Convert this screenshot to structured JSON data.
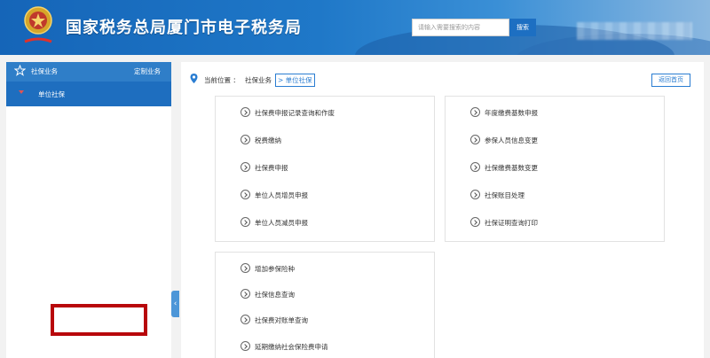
{
  "header": {
    "title": "国家税务总局厦门市电子税务局",
    "search_placeholder": "请输入需要搜索的内容",
    "search_button": "搜索",
    "brand_color": "#1f78c8"
  },
  "sidebar": {
    "section_label": "社保业务",
    "custom_label": "定制业务",
    "active_item": "单位社保",
    "collapse_glyph": "‹"
  },
  "main": {
    "location_label": "当前位置 ：",
    "crumb": "社保业务",
    "current": "> 单位社保",
    "home_button": "返回首页"
  },
  "panels": [
    {
      "items": [
        "社保费申报记录查询和作废",
        "税费缴纳",
        "社保费申报",
        "单位人员增员申报",
        "单位人员减员申报"
      ]
    },
    {
      "items": [
        "年度缴费基数申报",
        "参保人员信息变更",
        "社保缴费基数变更",
        "社保账目处理",
        "社保证明查询打印"
      ]
    },
    {
      "items": [
        "增加参保险种",
        "社保信息查询",
        "社保费对账单查询",
        "延期缴纳社会保险费申请"
      ]
    }
  ],
  "highlight_color": "#b8070b",
  "icons": [
    "emblem-icon",
    "star-icon",
    "location-pin-icon",
    "chevron-circle-icon"
  ]
}
